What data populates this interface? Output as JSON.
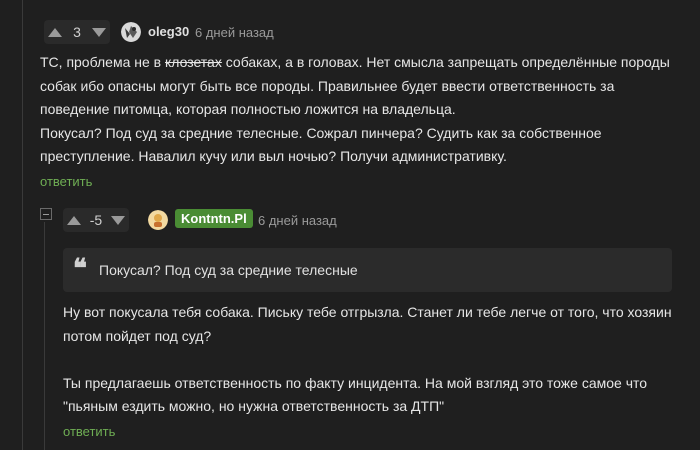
{
  "comment1": {
    "votes": "3",
    "username": "oleg30",
    "time": "6 дней назад",
    "text_before_strike": "ТС, проблема не в ",
    "strike_word": "клозетах",
    "text_after_strike": " собаках, а в головах. Нет смысла запрещать определённые породы собак ибо опасны могут быть все породы. Правильнее будет ввести ответственность за поведение питомца, которая полностью ложится на владельца.",
    "paragraph2": "Покусал? Под суд за средние телесные. Сожрал пинчера? Судить как за собственное преступление. Навалил кучу или выл ночью? Получи административку.",
    "reply_label": "ответить"
  },
  "comment2": {
    "votes": "-5",
    "username": "Kontntn.Pl",
    "time": "6 дней назад",
    "quote": "Покусал? Под суд за средние телесные",
    "paragraph1": "Ну вот покусала тебя собака. Письку тебе отгрызла. Станет ли тебе легче от того, что хозяин потом пойдет под суд?",
    "paragraph2": "Ты предлагаешь ответственность по факту инцидента. На мой взгляд это тоже самое что \"пьяным ездить можно, но нужна ответственность за ДТП\"",
    "reply_label": "ответить"
  },
  "colors": {
    "background": "#1f1f1f",
    "accent_green": "#6fae54",
    "badge_green": "#4a8c34"
  }
}
